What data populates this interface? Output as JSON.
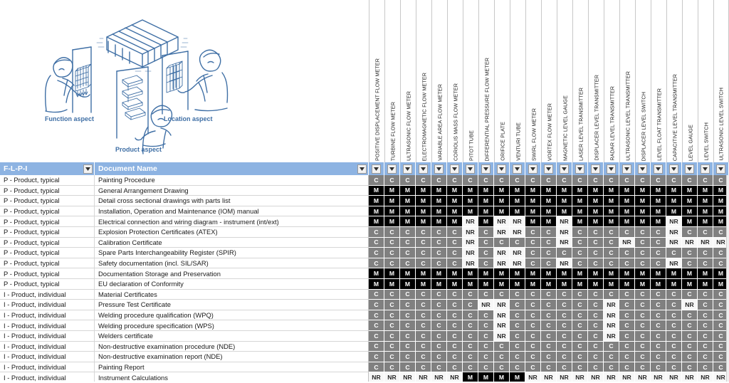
{
  "illustration": {
    "name": "aspect-diagram",
    "labels": {
      "function": "Function aspect",
      "location": "Location aspect",
      "product": "Product aspect"
    },
    "line_color": "#3f6fa5"
  },
  "theme": {
    "header_bg": "#8db3e2",
    "header_text": "#ffffff",
    "cell_M_bg": "#000000",
    "cell_C_bg": "#808080",
    "cell_NR_bg": "#f7f7f7"
  },
  "header": {
    "flpi_label": "F-L-P-I",
    "document_label": "Document Name",
    "filter_icon": "chevron-down-icon"
  },
  "legend": {
    "M": "M",
    "C": "C",
    "NR": "NR"
  },
  "columns": [
    "POSITIVE DISPLACEMENT FLOW METER",
    "TURBINE FLOW METER",
    "ULTRASONIC FLOW METER",
    "ELECTROMAGNETIC FLOW METER",
    "VARIABLE AREA FLOW METER",
    "CORIOLIS MASS FLOW METER",
    "PITOT TUBE",
    "DIFFERENTIAL PRESSURE FLOW METER",
    "ORIFICE PLATE",
    "VENTURI TUBE",
    "SWIRL FLOW METER",
    "VORTEX FLOW METER",
    "MAGNETIC LEVEL GAUGE",
    "LASER LEVEL TRANSMITTER",
    "DISPLACER LEVEL TRANSMITTER",
    "RADAR LEVEL TRANSMITTER",
    "ULTRASONIC LEVEL TRANSMITTER",
    "DISPLACER LEVEL SWITCH",
    "LEVEL FLOAT TRANSMITTER",
    "CAPACITIVE LEVEL TRANSMITTER",
    "LEVEL GAUGE",
    "LEVEL SWITCH",
    "ULTRASONIC LEVEL SWITCH"
  ],
  "rows": [
    {
      "flpi": "P - Product, typical",
      "document": "Painting Procedure",
      "values": [
        "C",
        "C",
        "C",
        "C",
        "C",
        "C",
        "C",
        "C",
        "C",
        "C",
        "C",
        "C",
        "C",
        "C",
        "C",
        "C",
        "C",
        "C",
        "C",
        "C",
        "C",
        "C",
        "C"
      ]
    },
    {
      "flpi": "P - Product, typical",
      "document": "General Arrangement Drawing",
      "values": [
        "M",
        "M",
        "M",
        "M",
        "M",
        "M",
        "M",
        "M",
        "M",
        "M",
        "M",
        "M",
        "M",
        "M",
        "M",
        "M",
        "M",
        "M",
        "M",
        "M",
        "M",
        "M",
        "M"
      ]
    },
    {
      "flpi": "P - Product, typical",
      "document": "Detail cross sectional drawings with parts list",
      "values": [
        "M",
        "M",
        "M",
        "M",
        "M",
        "M",
        "M",
        "M",
        "M",
        "M",
        "M",
        "M",
        "M",
        "M",
        "M",
        "M",
        "M",
        "M",
        "M",
        "M",
        "M",
        "M",
        "M"
      ]
    },
    {
      "flpi": "P - Product, typical",
      "document": "Installation, Operation and Maintenance (IOM) manual",
      "values": [
        "M",
        "M",
        "M",
        "M",
        "M",
        "M",
        "M",
        "M",
        "M",
        "M",
        "M",
        "M",
        "M",
        "M",
        "M",
        "M",
        "M",
        "M",
        "M",
        "M",
        "M",
        "M",
        "M"
      ]
    },
    {
      "flpi": "P - Product, typical",
      "document": "Electrical connection and wiring diagram - instrument (int/ext)",
      "values": [
        "M",
        "M",
        "M",
        "M",
        "M",
        "M",
        "NR",
        "M",
        "NR",
        "NR",
        "M",
        "M",
        "NR",
        "M",
        "M",
        "M",
        "M",
        "M",
        "M",
        "NR",
        "M",
        "M",
        "M"
      ]
    },
    {
      "flpi": "P - Product, typical",
      "document": "Explosion Protection Certificates (ATEX)",
      "values": [
        "C",
        "C",
        "C",
        "C",
        "C",
        "C",
        "NR",
        "C",
        "NR",
        "NR",
        "C",
        "C",
        "NR",
        "C",
        "C",
        "C",
        "C",
        "C",
        "C",
        "NR",
        "C",
        "C",
        "C"
      ]
    },
    {
      "flpi": "P - Product, typical",
      "document": "Calibration Certificate",
      "values": [
        "C",
        "C",
        "C",
        "C",
        "C",
        "C",
        "NR",
        "C",
        "C",
        "C",
        "C",
        "C",
        "NR",
        "C",
        "C",
        "C",
        "NR",
        "C",
        "C",
        "NR",
        "NR",
        "NR",
        "NR"
      ]
    },
    {
      "flpi": "P - Product, typical",
      "document": "Spare Parts Interchangeability Register (SPIR)",
      "values": [
        "C",
        "C",
        "C",
        "C",
        "C",
        "C",
        "NR",
        "C",
        "NR",
        "NR",
        "C",
        "C",
        "C",
        "C",
        "C",
        "C",
        "C",
        "C",
        "C",
        "C",
        "C",
        "C",
        "C"
      ]
    },
    {
      "flpi": "P - Product, typical",
      "document": "Safety documentation (incl. SIL/SAR)",
      "values": [
        "C",
        "C",
        "C",
        "C",
        "C",
        "C",
        "NR",
        "C",
        "NR",
        "NR",
        "C",
        "C",
        "NR",
        "C",
        "C",
        "C",
        "C",
        "C",
        "C",
        "NR",
        "C",
        "C",
        "C"
      ]
    },
    {
      "flpi": "P - Product, typical",
      "document": "Documentation Storage and Preservation",
      "values": [
        "M",
        "M",
        "M",
        "M",
        "M",
        "M",
        "M",
        "M",
        "M",
        "M",
        "M",
        "M",
        "M",
        "M",
        "M",
        "M",
        "M",
        "M",
        "M",
        "M",
        "M",
        "M",
        "M"
      ]
    },
    {
      "flpi": "P - Product, typical",
      "document": "EU declaration of Conformity",
      "values": [
        "M",
        "M",
        "M",
        "M",
        "M",
        "M",
        "M",
        "M",
        "M",
        "M",
        "M",
        "M",
        "M",
        "M",
        "M",
        "M",
        "M",
        "M",
        "M",
        "M",
        "M",
        "M",
        "M"
      ]
    },
    {
      "flpi": "I - Product, individual",
      "document": "Material Certificates",
      "values": [
        "C",
        "C",
        "C",
        "C",
        "C",
        "C",
        "C",
        "C",
        "C",
        "C",
        "C",
        "C",
        "C",
        "C",
        "C",
        "C",
        "C",
        "C",
        "C",
        "C",
        "C",
        "C",
        "C"
      ]
    },
    {
      "flpi": "I - Product, individual",
      "document": "Pressure Test Certificate",
      "values": [
        "C",
        "C",
        "C",
        "C",
        "C",
        "C",
        "C",
        "NR",
        "NR",
        "C",
        "C",
        "C",
        "C",
        "C",
        "C",
        "NR",
        "C",
        "C",
        "C",
        "C",
        "NR",
        "C",
        "C"
      ]
    },
    {
      "flpi": "I - Product, individual",
      "document": "Welding procedure qualification (WPQ)",
      "values": [
        "C",
        "C",
        "C",
        "C",
        "C",
        "C",
        "C",
        "C",
        "NR",
        "C",
        "C",
        "C",
        "C",
        "C",
        "C",
        "NR",
        "C",
        "C",
        "C",
        "C",
        "C",
        "C",
        "C"
      ]
    },
    {
      "flpi": "I - Product, individual",
      "document": "Welding procedure specification (WPS)",
      "values": [
        "C",
        "C",
        "C",
        "C",
        "C",
        "C",
        "C",
        "C",
        "NR",
        "C",
        "C",
        "C",
        "C",
        "C",
        "C",
        "NR",
        "C",
        "C",
        "C",
        "C",
        "C",
        "C",
        "C"
      ]
    },
    {
      "flpi": "I - Product, individual",
      "document": "Welders certificate",
      "values": [
        "C",
        "C",
        "C",
        "C",
        "C",
        "C",
        "C",
        "C",
        "NR",
        "C",
        "C",
        "C",
        "C",
        "C",
        "C",
        "NR",
        "C",
        "C",
        "C",
        "C",
        "C",
        "C",
        "C"
      ]
    },
    {
      "flpi": "I - Product, individual",
      "document": "Non-destructive examination procedure (NDE)",
      "values": [
        "C",
        "C",
        "C",
        "C",
        "C",
        "C",
        "C",
        "C",
        "C",
        "C",
        "C",
        "C",
        "C",
        "C",
        "C",
        "C",
        "C",
        "C",
        "C",
        "C",
        "C",
        "C",
        "C"
      ]
    },
    {
      "flpi": "I - Product, individual",
      "document": "Non-destructive examination report (NDE)",
      "values": [
        "C",
        "C",
        "C",
        "C",
        "C",
        "C",
        "C",
        "C",
        "C",
        "C",
        "C",
        "C",
        "C",
        "C",
        "C",
        "C",
        "C",
        "C",
        "C",
        "C",
        "C",
        "C",
        "C"
      ]
    },
    {
      "flpi": "I - Product, individual",
      "document": "Painting Report",
      "values": [
        "C",
        "C",
        "C",
        "C",
        "C",
        "C",
        "C",
        "C",
        "C",
        "C",
        "C",
        "C",
        "C",
        "C",
        "C",
        "C",
        "C",
        "C",
        "C",
        "C",
        "C",
        "C",
        "C"
      ]
    },
    {
      "flpi": "I - Product, individual",
      "document": "Instrument Calculations",
      "values": [
        "NR",
        "NR",
        "NR",
        "NR",
        "NR",
        "NR",
        "M",
        "M",
        "M",
        "M",
        "NR",
        "NR",
        "NR",
        "NR",
        "NR",
        "NR",
        "NR",
        "NR",
        "NR",
        "NR",
        "NR",
        "NR",
        "NR"
      ]
    }
  ]
}
